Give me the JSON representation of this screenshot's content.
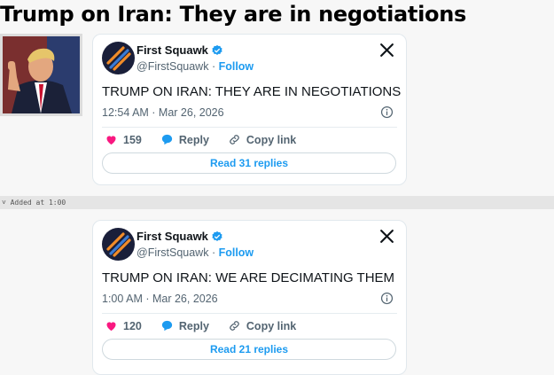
{
  "headline": "Trump on Iran: They are in negotiations",
  "added_marker": "˅ Added at 1:00",
  "tweets": [
    {
      "name": "First Squawk",
      "handle": "@FirstSquawk",
      "follow_label": "Follow",
      "text": "TRUMP ON IRAN: THEY ARE IN NEGOTIATIONS",
      "timestamp": "12:54 AM · Mar 26, 2026",
      "likes": "159",
      "reply_label": "Reply",
      "copy_label": "Copy link",
      "read_replies": "Read 31 replies"
    },
    {
      "name": "First Squawk",
      "handle": "@FirstSquawk",
      "follow_label": "Follow",
      "text": "TRUMP ON IRAN: WE ARE DECIMATING THEM",
      "timestamp": "1:00 AM · Mar 26, 2026",
      "likes": "120",
      "reply_label": "Reply",
      "copy_label": "Copy link",
      "read_replies": "Read 21 replies"
    }
  ],
  "colors": {
    "accent": "#1d9bf0",
    "like": "#f91880",
    "avatar_bg": "#1a1f3a",
    "avatar_orange": "#f28c28",
    "avatar_blue": "#3a7bd5"
  },
  "icons": [
    "verified-badge-icon",
    "x-logo-icon",
    "info-icon",
    "heart-icon",
    "reply-bubble-icon",
    "link-icon"
  ]
}
